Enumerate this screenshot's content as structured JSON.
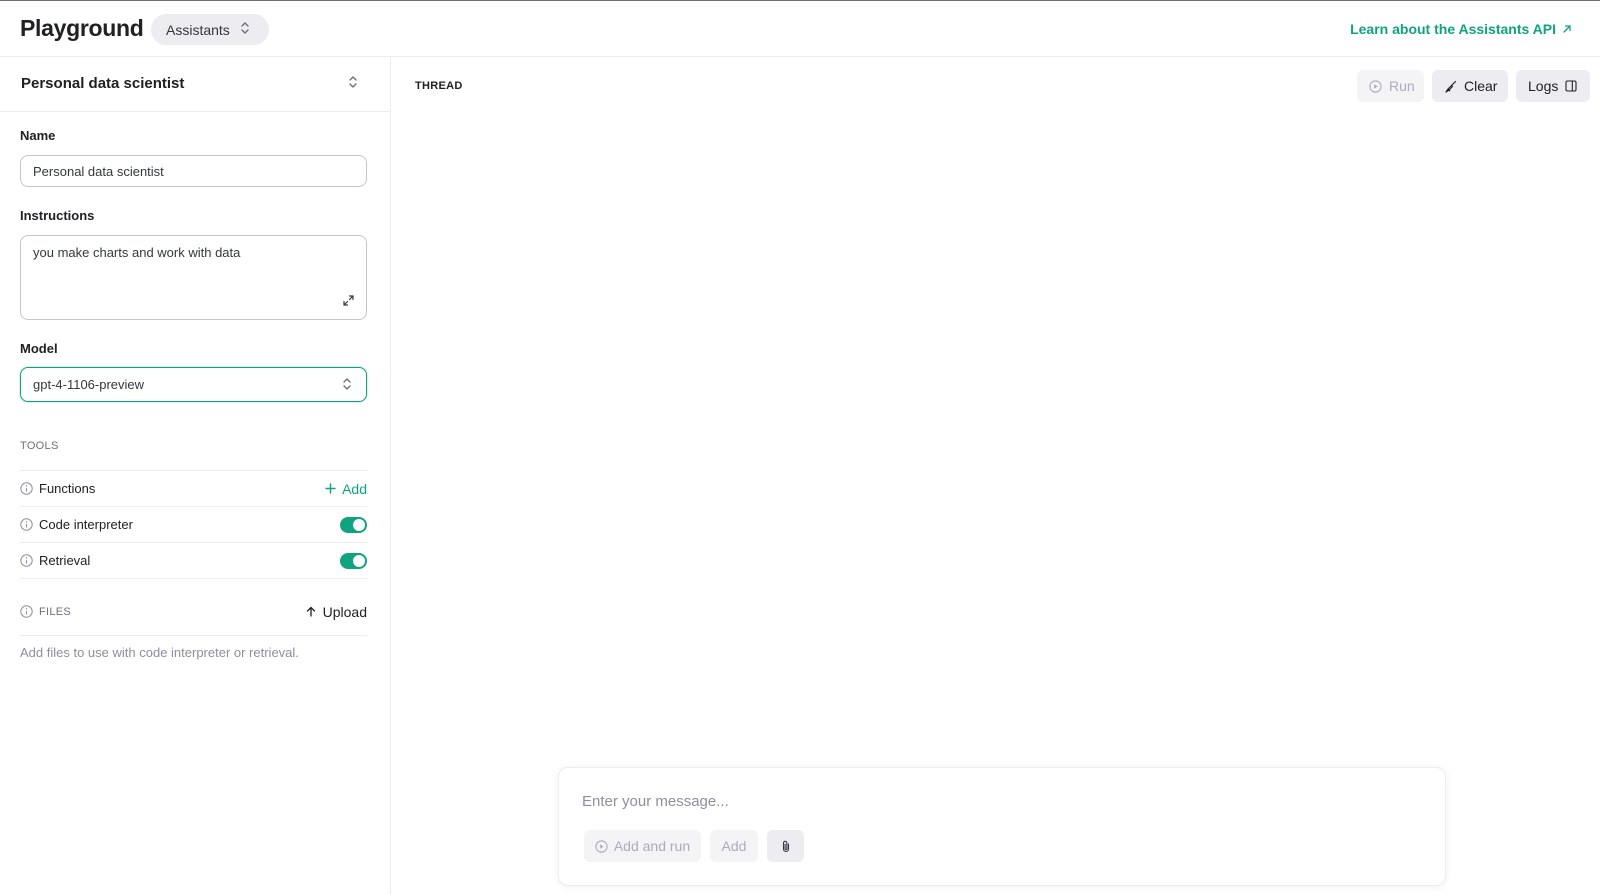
{
  "header": {
    "title": "Playground",
    "mode": "Assistants",
    "learn_link": "Learn about the Assistants API"
  },
  "sidebar": {
    "assistant_selected": "Personal data scientist",
    "name_label": "Name",
    "name_value": "Personal data scientist",
    "instructions_label": "Instructions",
    "instructions_value": "you make charts and work with data",
    "model_label": "Model",
    "model_value": "gpt-4-1106-preview",
    "tools_label": "TOOLS",
    "tools": [
      {
        "name": "Functions",
        "action": "Add"
      },
      {
        "name": "Code interpreter",
        "enabled": true
      },
      {
        "name": "Retrieval",
        "enabled": true
      }
    ],
    "files_label": "FILES",
    "upload_label": "Upload",
    "files_hint": "Add files to use with code interpreter or retrieval."
  },
  "thread": {
    "label": "THREAD",
    "run_label": "Run",
    "clear_label": "Clear",
    "logs_label": "Logs"
  },
  "composer": {
    "placeholder": "Enter your message...",
    "add_and_run_label": "Add and run",
    "add_label": "Add"
  },
  "colors": {
    "accent": "#10a37f",
    "border": "#ececf1",
    "muted_text": "#8e8ea0"
  },
  "icons": [
    "chevron-updown-icon",
    "arrow-up-right-icon",
    "expand-icon",
    "info-icon",
    "plus-icon",
    "upload-arrow-icon",
    "play-circle-icon",
    "broom-icon",
    "panel-icon",
    "paperclip-icon"
  ]
}
